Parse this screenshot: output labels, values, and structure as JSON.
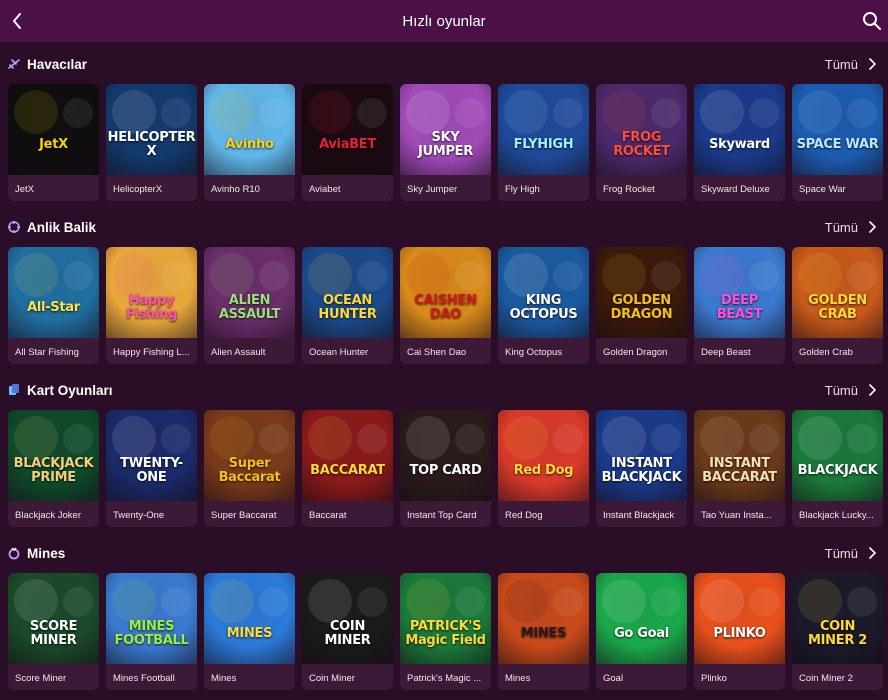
{
  "header": {
    "title": "Hızlı oyunlar",
    "back_icon": "chevron-left-icon",
    "search_icon": "search-icon",
    "bg": "#4b1045"
  },
  "sections": [
    {
      "title": "Havacılar",
      "icon": "plane-icon",
      "all_label": "Tümü",
      "games": [
        {
          "name": "JetX",
          "art": "JetX",
          "bg": "#0e0e0e",
          "fg": "#f5d400"
        },
        {
          "name": "HelicopterX",
          "art": "HELICOPTER X",
          "bg": "#123a6e",
          "fg": "#ffffff"
        },
        {
          "name": "Avinho R10",
          "art": "Avinho",
          "bg": "#5fb6e8",
          "fg": "#f6d21c"
        },
        {
          "name": "Aviabet",
          "art": "AviaBET",
          "bg": "#1a0a10",
          "fg": "#e3203a"
        },
        {
          "name": "Sky Jumper",
          "art": "SKY JUMPER",
          "bg": "#a04bb8",
          "fg": "#ffffff"
        },
        {
          "name": "Fly High",
          "art": "FLYHIGH",
          "bg": "#1f4a9a",
          "fg": "#9ef0ff"
        },
        {
          "name": "Frog Rocket",
          "art": "FROG ROCKET",
          "bg": "#4a2a6a",
          "fg": "#ff4d3a"
        },
        {
          "name": "Skyward Deluxe",
          "art": "Skyward",
          "bg": "#1a3a8a",
          "fg": "#ffffff"
        },
        {
          "name": "Space War",
          "art": "SPACE WAR",
          "bg": "#1c5cb0",
          "fg": "#bfe8ff"
        }
      ]
    },
    {
      "title": "Anlik Balik",
      "icon": "crosshair-icon",
      "all_label": "Tümü",
      "games": [
        {
          "name": "All Star Fishing",
          "art": "All-Star",
          "bg": "#1f6fa0",
          "fg": "#ffe14a"
        },
        {
          "name": "Happy Fishing L...",
          "art": "Happy Fishing",
          "bg": "#e8a83a",
          "fg": "#ff4fa8"
        },
        {
          "name": "Alien Assault",
          "art": "ALIEN ASSAULT",
          "bg": "#6a2e6a",
          "fg": "#9be07a"
        },
        {
          "name": "Ocean Hunter",
          "art": "OCEAN HUNTER",
          "bg": "#1a4a8a",
          "fg": "#ffd93a"
        },
        {
          "name": "Cai Shen Dao",
          "art": "CAISHEN DAO",
          "bg": "#d88a1a",
          "fg": "#d11a1a"
        },
        {
          "name": "King Octopus",
          "art": "KING OCTOPUS",
          "bg": "#1a5aa0",
          "fg": "#ffffff"
        },
        {
          "name": "Golden Dragon",
          "art": "GOLDEN DRAGON",
          "bg": "#3a1a0a",
          "fg": "#f5c01a"
        },
        {
          "name": "Deep Beast",
          "art": "DEEP BEAST",
          "bg": "#3a7ad0",
          "fg": "#ff4fd8"
        },
        {
          "name": "Golden Crab",
          "art": "GOLDEN CRAB",
          "bg": "#c85a1a",
          "fg": "#ffd93a"
        }
      ]
    },
    {
      "title": "Kart Oyunları",
      "icon": "cards-icon",
      "all_label": "Tümü",
      "games": [
        {
          "name": "Blackjack Joker",
          "art": "BLACKJACK PRIME",
          "bg": "#0e4a2a",
          "fg": "#f5d07a"
        },
        {
          "name": "Twenty-One",
          "art": "TWENTY-ONE",
          "bg": "#1a2a6a",
          "fg": "#ffffff"
        },
        {
          "name": "Super Baccarat",
          "art": "Super Baccarat",
          "bg": "#7a3a1a",
          "fg": "#f5c01a"
        },
        {
          "name": "Baccarat",
          "art": "BACCARAT",
          "bg": "#8a1a1a",
          "fg": "#ffd93a"
        },
        {
          "name": "Instant Top Card",
          "art": "TOP CARD",
          "bg": "#2a1a1a",
          "fg": "#ffffff"
        },
        {
          "name": "Red Dog",
          "art": "Red Dog",
          "bg": "#d83a2a",
          "fg": "#ffd93a"
        },
        {
          "name": "Instant Blackjack",
          "art": "INSTANT BLACKJACK",
          "bg": "#1a3a8a",
          "fg": "#ffffff"
        },
        {
          "name": "Tao Yuan Insta...",
          "art": "INSTANT BACCARAT",
          "bg": "#6a3a1a",
          "fg": "#f5e0b0"
        },
        {
          "name": "Blackjack Lucky...",
          "art": "BLACKJACK",
          "bg": "#1a7a3a",
          "fg": "#ffffff"
        }
      ]
    },
    {
      "title": "Mines",
      "icon": "ring-icon",
      "all_label": "Tümü",
      "games": [
        {
          "name": "Score Miner",
          "art": "SCORE MINER",
          "bg": "#1a4a2a",
          "fg": "#ffffff"
        },
        {
          "name": "Mines Football",
          "art": "MINES FOOTBALL",
          "bg": "#3a7ad0",
          "fg": "#9bf03a"
        },
        {
          "name": "Mines",
          "art": "MINES",
          "bg": "#2a7ad8",
          "fg": "#ffd93a"
        },
        {
          "name": "Coin Miner",
          "art": "COIN MINER",
          "bg": "#1a1a1a",
          "fg": "#ffffff"
        },
        {
          "name": "Patrick's Magic ...",
          "art": "PATRICK'S Magic Field",
          "bg": "#1a7a3a",
          "fg": "#ffd93a"
        },
        {
          "name": "Mines",
          "art": "MINES",
          "bg": "#c84a1a",
          "fg": "#2a1a1a"
        },
        {
          "name": "Goal",
          "art": "Go Goal",
          "bg": "#1aa84a",
          "fg": "#ffffff"
        },
        {
          "name": "Plinko",
          "art": "PLINKO",
          "bg": "#e8501a",
          "fg": "#ffffff"
        },
        {
          "name": "Coin Miner 2",
          "art": "COIN MINER 2",
          "bg": "#1a1a2a",
          "fg": "#ffd93a"
        }
      ]
    }
  ]
}
